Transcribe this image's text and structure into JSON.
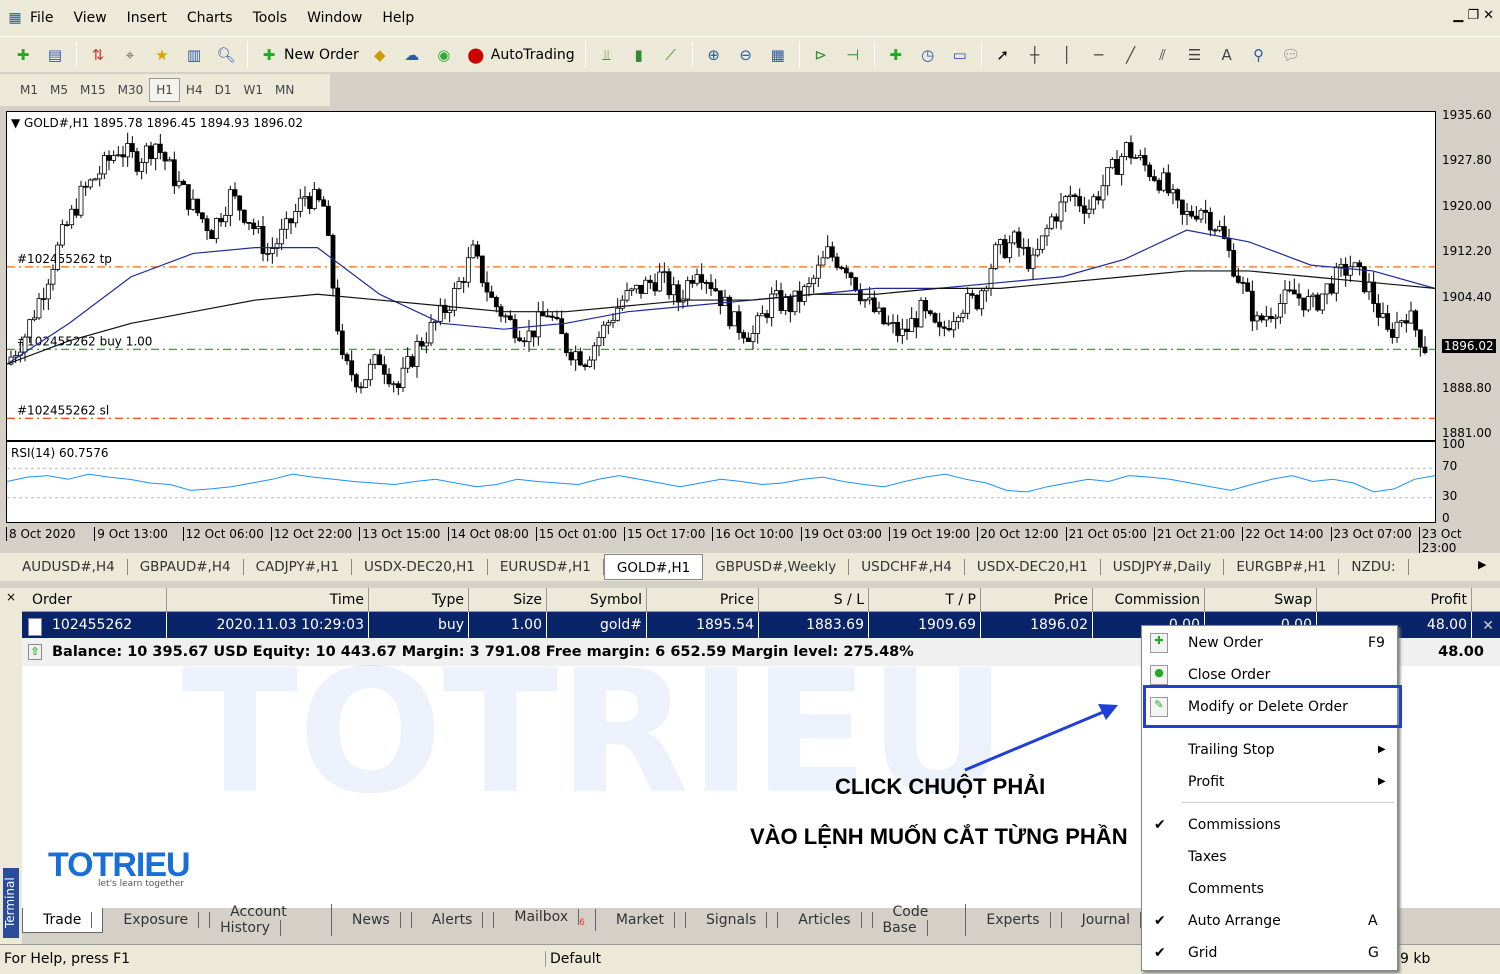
{
  "menu": [
    "File",
    "View",
    "Insert",
    "Charts",
    "Tools",
    "Window",
    "Help"
  ],
  "toolbar": {
    "new_order": "New Order",
    "autotrading": "AutoTrading"
  },
  "timeframes": [
    "M1",
    "M5",
    "M15",
    "M30",
    "H1",
    "H4",
    "D1",
    "W1",
    "MN"
  ],
  "active_timeframe": "H1",
  "chart": {
    "header": "GOLD#,H1  1895.78 1896.45 1894.93 1896.02",
    "price_ticks": [
      "1935.60",
      "1927.80",
      "1920.00",
      "1912.20",
      "1904.40",
      "1896.02",
      "1888.80",
      "1881.00"
    ],
    "price_range": [
      1881.0,
      1935.6
    ],
    "current_price": "1896.02",
    "order_lines": [
      {
        "label": "#102455262 tp",
        "price": 1909.69,
        "color": "#ff6a00"
      },
      {
        "label": "#102455262 buy 1.00",
        "price": 1895.54,
        "color": "#2e8b2e"
      },
      {
        "label": "#102455262 sl",
        "price": 1883.69,
        "color": "#ff3300"
      }
    ],
    "closes": [
      1893,
      1898,
      1906,
      1915,
      1922,
      1926,
      1930,
      1928,
      1931,
      1925,
      1920,
      1916,
      1922,
      1918,
      1912,
      1916,
      1922,
      1920,
      1893,
      1890,
      1894,
      1889,
      1896,
      1900,
      1905,
      1912,
      1904,
      1900,
      1898,
      1902,
      1896,
      1894,
      1899,
      1904,
      1906,
      1908,
      1904,
      1910,
      1906,
      1900,
      1898,
      1904,
      1903,
      1906,
      1912,
      1910,
      1904,
      1900,
      1898,
      1902,
      1898,
      1903,
      1904,
      1912,
      1914,
      1910,
      1918,
      1922,
      1920,
      1925,
      1930,
      1927,
      1924,
      1918,
      1920,
      1916,
      1908,
      1900,
      1903,
      1905,
      1903,
      1907,
      1910,
      1906,
      1898,
      1902,
      1896
    ],
    "ma_fast": [
      1893,
      1900,
      1908,
      1912,
      1913,
      1913,
      1905,
      1900,
      1899,
      1900,
      1902,
      1903,
      1904,
      1905,
      1906,
      1906,
      1907,
      1908,
      1911,
      1916,
      1914,
      1910,
      1909,
      1906
    ],
    "ma_slow": [
      1893,
      1897,
      1900,
      1902,
      1904,
      1905,
      1904,
      1903,
      1902,
      1902,
      1903,
      1904,
      1904,
      1905,
      1905,
      1906,
      1906,
      1907,
      1908,
      1909,
      1909,
      1908,
      1907,
      1906
    ],
    "rsi_label": "RSI(14) 60.7576",
    "rsi_ticks": [
      "100",
      "70",
      "30",
      "0"
    ],
    "rsi_values": [
      52,
      58,
      60,
      55,
      62,
      58,
      55,
      50,
      48,
      40,
      42,
      45,
      50,
      55,
      62,
      58,
      55,
      52,
      50,
      48,
      52,
      55,
      50,
      45,
      48,
      55,
      52,
      50,
      48,
      55,
      60,
      55,
      50,
      45,
      50,
      55,
      52,
      48,
      50,
      55,
      58,
      52,
      48,
      45,
      52,
      58,
      62,
      55,
      50,
      40,
      38,
      45,
      50,
      55,
      52,
      60,
      58,
      55,
      50,
      45,
      40,
      48,
      55,
      60,
      52,
      55,
      50,
      38,
      42,
      55,
      60
    ]
  },
  "time_ticks": [
    "8 Oct 2020",
    "9 Oct 13:00",
    "12 Oct 06:00",
    "12 Oct 22:00",
    "13 Oct 15:00",
    "14 Oct 08:00",
    "15 Oct 01:00",
    "15 Oct 17:00",
    "16 Oct 10:00",
    "19 Oct 03:00",
    "19 Oct 19:00",
    "20 Oct 12:00",
    "21 Oct 05:00",
    "21 Oct 21:00",
    "22 Oct 14:00",
    "23 Oct 07:00",
    "23 Oct 23:00"
  ],
  "symbol_tabs": [
    "AUDUSD#,H4",
    "GBPAUD#,H4",
    "CADJPY#,H1",
    "USDX-DEC20,H1",
    "EURUSD#,H1",
    "GOLD#,H1",
    "GBPUSD#,Weekly",
    "USDCHF#,H4",
    "USDX-DEC20,H1",
    "USDJPY#,Daily",
    "EURGBP#,H1",
    "NZDU:"
  ],
  "active_symbol_tab": "GOLD#,H1",
  "terminal": {
    "columns": [
      "Order",
      "Time",
      "Type",
      "Size",
      "Symbol",
      "Price",
      "S / L",
      "T / P",
      "Price",
      "Commission",
      "Swap",
      "Profit"
    ],
    "row": [
      "102455262",
      "2020.11.03 10:29:03",
      "buy",
      "1.00",
      "gold#",
      "1895.54",
      "1883.69",
      "1909.69",
      "1896.02",
      "0.00",
      "0.00",
      "48.00"
    ],
    "balance_line": "Balance: 10 395.67 USD  Equity: 10 443.67  Margin: 3 791.08  Free margin: 6 652.59  Margin level: 275.48%",
    "total_profit": "48.00",
    "side_label": "Terminal",
    "tabs": [
      "Trade",
      "Exposure",
      "Account History",
      "News",
      "Alerts",
      "Mailbox",
      "Market",
      "Signals",
      "Articles",
      "Code Base",
      "Experts",
      "Journal"
    ],
    "mailbox_badge": "6",
    "active_tab": "Trade"
  },
  "context_menu": [
    {
      "label": "New Order",
      "shortcut": "F9"
    },
    {
      "label": "Close Order"
    },
    {
      "label": "Modify or Delete Order",
      "highlighted": true
    },
    {
      "label": "Trailing Stop",
      "submenu": true
    },
    {
      "label": "Profit",
      "submenu": true
    },
    {
      "label": "Commissions",
      "checked": true
    },
    {
      "label": "Taxes"
    },
    {
      "label": "Comments"
    },
    {
      "label": "Auto Arrange",
      "shortcut": "A",
      "checked": true
    },
    {
      "label": "Grid",
      "shortcut": "G",
      "checked": true
    }
  ],
  "annotation": {
    "line1": "CLICK CHUỘT PHẢI",
    "line2": "VÀO LỆNH MUỐN CẮT TỪNG PHẦN",
    "color": "#1f3fd6"
  },
  "watermark": {
    "logo": "TOTRIEU",
    "tagline": "let's learn together"
  },
  "status": {
    "help": "For Help, press F1",
    "profile": "Default",
    "traffic": "9 kb"
  }
}
